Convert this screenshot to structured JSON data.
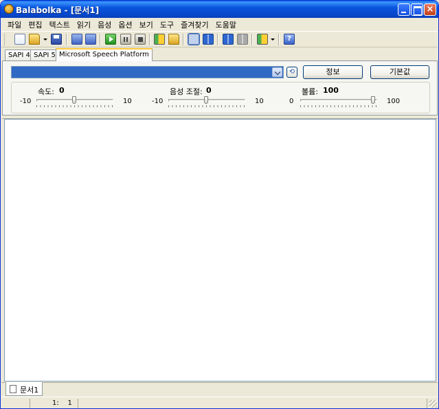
{
  "window": {
    "title": "Balabolka - [문서1]"
  },
  "title_buttons": {
    "minimize": "minimize",
    "maximize": "maximize",
    "close": "×"
  },
  "menu": [
    "파일",
    "편집",
    "텍스트",
    "읽기",
    "음성",
    "옵션",
    "보기",
    "도구",
    "즐겨찾기",
    "도움말"
  ],
  "toolbar": {
    "icons": [
      "new-document-icon",
      "open-file-icon",
      "save-icon",
      "save-audio-icon",
      "batch-convert-icon",
      "play-icon",
      "pause-icon",
      "stop-icon",
      "voices-icon",
      "lexicon-icon",
      "text-view-icon",
      "book-icon",
      "book-gray-icon",
      "clip-icon",
      "split-icon",
      "help-icon"
    ],
    "help_glyph": "?"
  },
  "tabs": {
    "items": [
      "SAPI 4",
      "SAPI 5",
      "Microsoft Speech Platform"
    ],
    "active": "Microsoft Speech Platform"
  },
  "voice_panel": {
    "selected_voice": "",
    "refresh_glyph": "⟲",
    "info_button": "정보",
    "default_button": "기본값"
  },
  "sliders": {
    "rate": {
      "label": "속도:",
      "value": "0",
      "min": "-10",
      "max": "10",
      "fraction": 0.5
    },
    "pitch": {
      "label": "음성 조절:",
      "value": "0",
      "min": "-10",
      "max": "10",
      "fraction": 0.5
    },
    "volume": {
      "label": "볼륨:",
      "value": "100",
      "min": "0",
      "max": "100",
      "fraction": 1.0
    }
  },
  "editor": {
    "content": ""
  },
  "document_tabs": [
    "문서1"
  ],
  "status": {
    "position": "1:    1"
  },
  "colors": {
    "titlebar": "#0855dd",
    "selection": "#316ac5",
    "face": "#ece9d8"
  }
}
